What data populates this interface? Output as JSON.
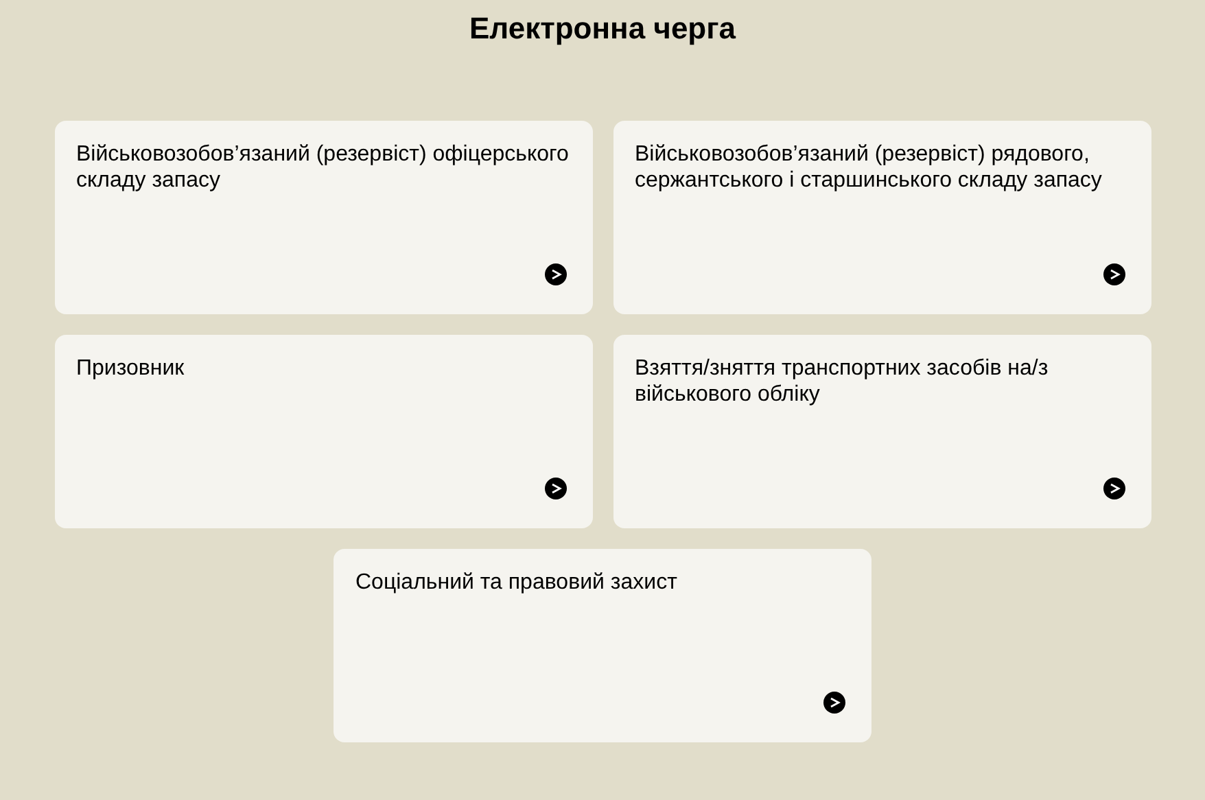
{
  "title": "Електронна черга",
  "cards": [
    {
      "label": "Військовозобов’язаний (резервіст) офіцерського складу запасу"
    },
    {
      "label": "Військовозобов’язаний (резервіст) рядового, сержантського і старшинського складу запасу"
    },
    {
      "label": "Призовник"
    },
    {
      "label": "Взяття/зняття транспортних засобів на/з військового обліку"
    },
    {
      "label": "Соціальний та правовий захист"
    }
  ]
}
